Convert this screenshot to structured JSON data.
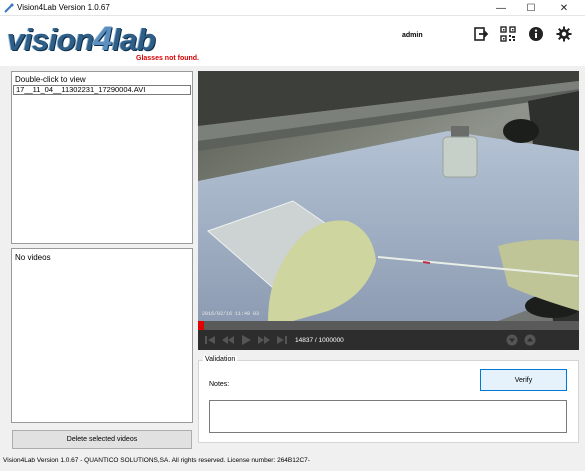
{
  "window": {
    "title": "Vision4Lab Version 1.0.67"
  },
  "header": {
    "logo": {
      "part1": "vision",
      "part2": "4",
      "part3": "lab"
    },
    "glasses_status": "Glasses not found.",
    "user": "admin",
    "icons": [
      "logout-icon",
      "qr-code-icon",
      "info-icon",
      "settings-icon"
    ]
  },
  "video_list": {
    "title": "Double-click to view",
    "items": [
      "17__11_04__11302231_17290004.AVI"
    ]
  },
  "selected_list": {
    "empty_text": "No videos"
  },
  "delete_button": "Delete selected videos",
  "player": {
    "timestamp": "2016/02/16 11:40 03",
    "counter": "14837 / 1000000",
    "progress": 0.015
  },
  "validation": {
    "title": "Validation",
    "notes_label": "Notes:",
    "notes_value": "",
    "verify_label": "Verify"
  },
  "footer": "Vision4Lab Version 1.0.67 - QUANTICO SOLUTIONS,SA. All rights reserved.  License number: 264B12C7-",
  "colors": {
    "accent_blue": "#2f5f86",
    "error_red": "#d80000",
    "seek_red": "#e00000"
  }
}
